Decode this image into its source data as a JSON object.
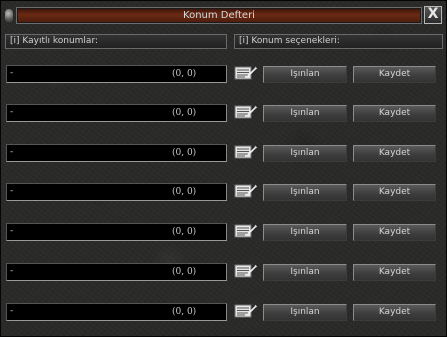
{
  "window": {
    "title": "Konum Defteri",
    "close_label": "X"
  },
  "headers": {
    "saved_locations": "[i] Kayıtlı konumlar:",
    "location_options": "[i] Konum seçenekleri:"
  },
  "rows": [
    {
      "name": "-",
      "coords": "(0, 0)",
      "teleport_label": "Işınlan",
      "save_label": "Kaydet",
      "icon": "edit-note-icon"
    },
    {
      "name": "-",
      "coords": "(0, 0)",
      "teleport_label": "Işınlan",
      "save_label": "Kaydet",
      "icon": "edit-note-icon"
    },
    {
      "name": "-",
      "coords": "(0, 0)",
      "teleport_label": "Işınlan",
      "save_label": "Kaydet",
      "icon": "edit-note-icon"
    },
    {
      "name": "-",
      "coords": "(0, 0)",
      "teleport_label": "Işınlan",
      "save_label": "Kaydet",
      "icon": "edit-note-icon"
    },
    {
      "name": "-",
      "coords": "(0, 0)",
      "teleport_label": "Işınlan",
      "save_label": "Kaydet",
      "icon": "edit-note-icon"
    },
    {
      "name": "-",
      "coords": "(0, 0)",
      "teleport_label": "Işınlan",
      "save_label": "Kaydet",
      "icon": "edit-note-icon"
    },
    {
      "name": "-",
      "coords": "(0, 0)",
      "teleport_label": "Işınlan",
      "save_label": "Kaydet",
      "icon": "edit-note-icon"
    }
  ],
  "colors": {
    "title_bar": "#6a2a14",
    "field_background": "#000000",
    "text": "#d6d6d6",
    "button": "#4a4a4a"
  }
}
